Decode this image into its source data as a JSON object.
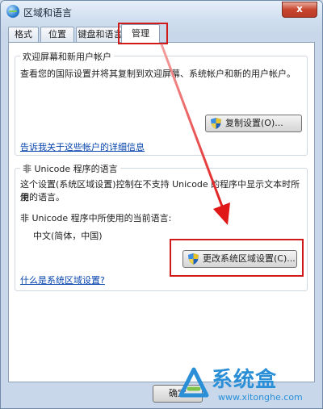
{
  "window": {
    "title": "区域和语言",
    "close_label": "x"
  },
  "tabs": [
    {
      "label": "格式"
    },
    {
      "label": "位置"
    },
    {
      "label": "键盘和语言"
    },
    {
      "label": "管理"
    }
  ],
  "welcome_group": {
    "legend": "欢迎屏幕和新用户帐户",
    "description": "查看您的国际设置并将其复制到欢迎屏幕、系统帐户和新的用户帐户。",
    "copy_button": "复制设置(O)...",
    "link": "告诉我关于这些帐户的详细信息"
  },
  "unicode_group": {
    "legend": "非 Unicode 程序的语言",
    "description_line1": "这个设置(系统区域设置)控制在不支持 Unicode 的程序中显示文本时所使",
    "description_line2": "用的语言。",
    "current_label": "非 Unicode 程序中所使用的当前语言:",
    "current_value": "中文(简体，中国)",
    "change_button": "更改系统区域设置(C)...",
    "link": "什么是系统区域设置?"
  },
  "footer": {
    "ok_button": "确定"
  },
  "watermark": {
    "brand": "系统盒",
    "url": "www.xitonghe.com"
  },
  "colors": {
    "annotation_red": "#d01a1a",
    "link_blue": "#0645ad",
    "brand_blue": "#2b8fd8"
  }
}
